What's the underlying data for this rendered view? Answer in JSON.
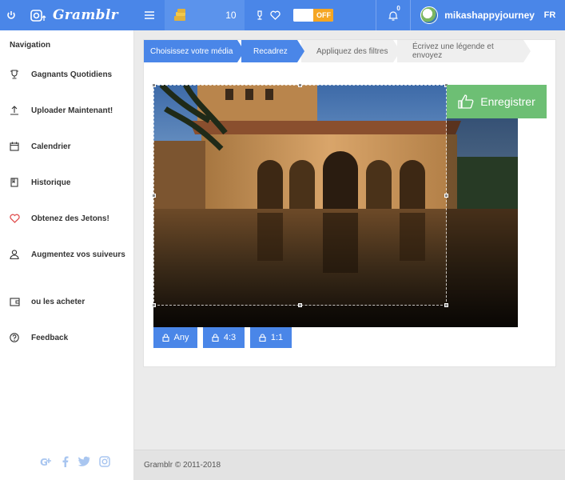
{
  "topbar": {
    "logo_text": "Gramblr",
    "coin_count": "10",
    "toggle_label": "OFF",
    "notification_count": "0",
    "username": "mikashappyjourney",
    "language": "FR"
  },
  "sidebar": {
    "title": "Navigation",
    "items": [
      {
        "label": "Gagnants Quotidiens"
      },
      {
        "label": "Uploader Maintenant!"
      },
      {
        "label": "Calendrier"
      },
      {
        "label": "Historique"
      },
      {
        "label": "Obtenez des Jetons!"
      },
      {
        "label": "Augmentez vos suiveurs"
      },
      {
        "label": "ou les acheter"
      },
      {
        "label": "Feedback"
      }
    ]
  },
  "steps": [
    {
      "label": "Choisissez votre média"
    },
    {
      "label": "Recadrez"
    },
    {
      "label": "Appliquez des filtres"
    },
    {
      "label": "Écrivez une légende et envoyez"
    }
  ],
  "editor": {
    "save_label": "Enregistrer",
    "ratios": [
      {
        "label": "Any"
      },
      {
        "label": "4:3"
      },
      {
        "label": "1:1"
      }
    ]
  },
  "footer": {
    "text": "Gramblr © 2011-2018"
  },
  "colors": {
    "accent": "#4a86e8",
    "save": "#6dbf74",
    "toggle_off": "#f5a623",
    "heart": "#e05050"
  }
}
